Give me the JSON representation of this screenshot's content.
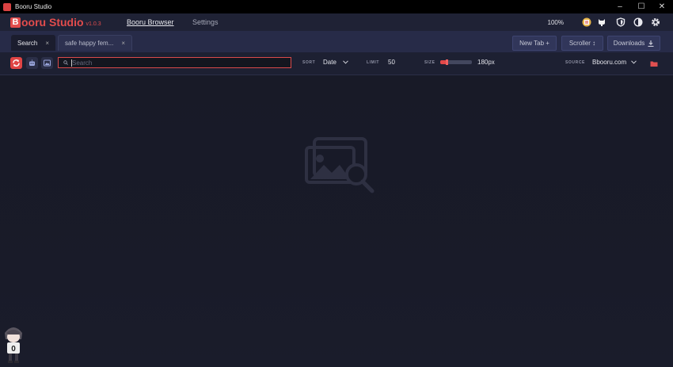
{
  "window": {
    "title": "Booru Studio",
    "minimize": "–",
    "maximize": "☐",
    "close": "✕"
  },
  "app": {
    "logo_letter": "B",
    "name": "ooru Studio",
    "version": "v1.0.3"
  },
  "nav": [
    {
      "label": "Booru Browser",
      "active": true
    },
    {
      "label": "Settings",
      "active": false
    }
  ],
  "zoom": "100%",
  "tabs": [
    {
      "label": "Search",
      "close": "×"
    },
    {
      "label": "safe happy fem...",
      "close": "×"
    }
  ],
  "actions": {
    "new_tab": "New Tab +",
    "scroller": "Scroller ↕",
    "downloads": "Downloads"
  },
  "toolbar": {
    "search_placeholder": "Search",
    "sort_label": "SORT",
    "sort_value": "Date",
    "limit_label": "LIMIT",
    "limit_value": "50",
    "size_label": "SIZE",
    "size_value": "180px",
    "size_fraction": 0.2,
    "source_label": "SOURCE",
    "source_value": "Bbooru.com"
  },
  "colors": {
    "accent": "#e24c4c",
    "background": "#181a27",
    "tabbar": "#272b48"
  },
  "icons": [
    "app-icon",
    "github-icon",
    "shield-icon",
    "contrast-icon",
    "gear-icon",
    "refresh-icon",
    "robot-icon",
    "image-icon",
    "search-icon",
    "chevron-down-icon",
    "folder-icon",
    "empty-image-search-icon"
  ]
}
